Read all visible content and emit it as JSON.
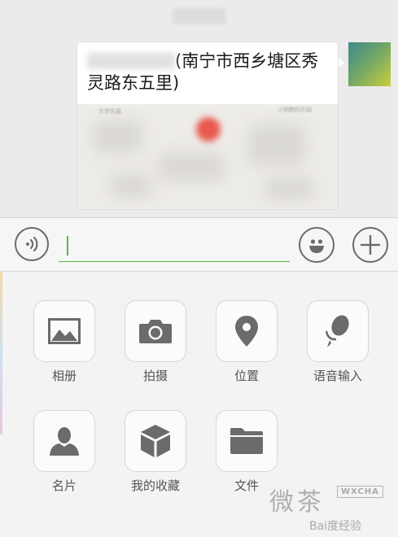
{
  "chat": {
    "message": {
      "address_text": "(南宁市西乡塘区秀灵路东五里)",
      "map_labels": [
        "大学东路",
        "小明数码乐园"
      ]
    }
  },
  "input": {
    "value": "",
    "voice_icon": "voice-icon",
    "emoji_icon": "emoji-icon",
    "plus_icon": "plus-icon"
  },
  "panel": {
    "items": [
      {
        "label": "相册",
        "icon": "photo-album-icon"
      },
      {
        "label": "拍摄",
        "icon": "camera-icon"
      },
      {
        "label": "位置",
        "icon": "location-pin-icon"
      },
      {
        "label": "语音输入",
        "icon": "microphone-icon"
      },
      {
        "label": "名片",
        "icon": "contact-card-icon"
      },
      {
        "label": "我的收藏",
        "icon": "favorites-box-icon"
      },
      {
        "label": "文件",
        "icon": "folder-icon"
      }
    ]
  },
  "watermark": {
    "brand": "微茶",
    "badge": "WXCHA",
    "baidu": "Bai度经验"
  },
  "colors": {
    "accent_green": "#55b940",
    "icon_gray": "#6b6b6b",
    "pin_red": "#e8584c"
  }
}
